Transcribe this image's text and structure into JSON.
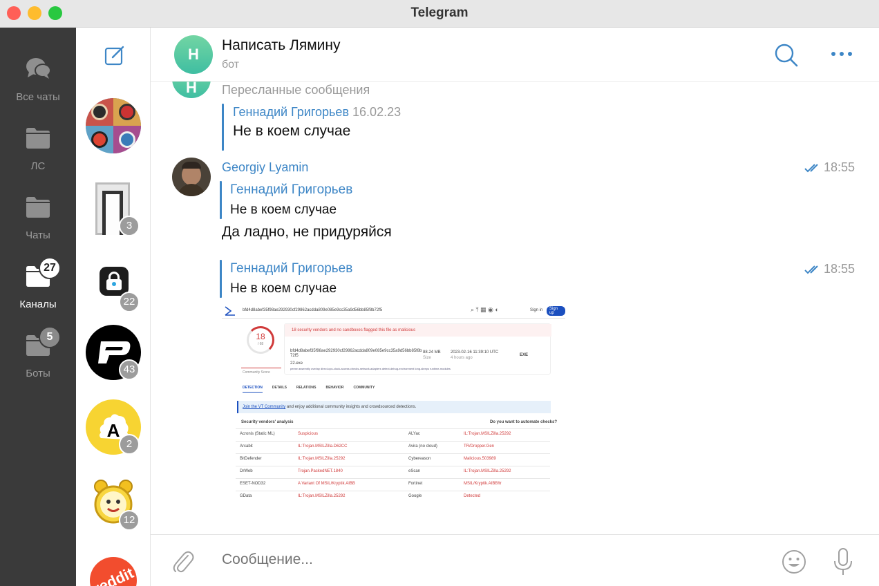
{
  "window": {
    "title": "Telegram"
  },
  "folders": [
    {
      "label": "Все чаты",
      "icon": "chats-bubbles-icon",
      "badge": ""
    },
    {
      "label": "ЛС",
      "icon": "folder-icon",
      "badge": ""
    },
    {
      "label": "Чаты",
      "icon": "folder-icon",
      "badge": ""
    },
    {
      "label": "Каналы",
      "icon": "folder-icon",
      "badge": "27",
      "active": true
    },
    {
      "label": "Боты",
      "icon": "folder-icon",
      "badge": "5"
    }
  ],
  "chat_list": [
    {
      "avatar": "rotary-phones-avatar",
      "badge": ""
    },
    {
      "avatar": "door-avatar",
      "badge": "3"
    },
    {
      "avatar": "lock-avatar",
      "badge": "22"
    },
    {
      "avatar": "p-logo-avatar",
      "badge": "43"
    },
    {
      "avatar": "a-logo-avatar",
      "badge": "2"
    },
    {
      "avatar": "alarm-clock-avatar",
      "badge": "12"
    },
    {
      "avatar": "reddit-avatar",
      "badge": ""
    }
  ],
  "header": {
    "avatar_letter": "Н",
    "name": "Написать Лямину",
    "status": "бот"
  },
  "messages": {
    "forwarded_group": {
      "title": "Пересланные сообщения",
      "author": "Геннадий Григорьев",
      "date": "16.02.23",
      "text": "Не в коем случае"
    },
    "msg1": {
      "sender": "Georgiy Lyamin",
      "time": "18:55",
      "reply_author": "Геннадий Григорьев",
      "reply_text": "Не в коем случае",
      "text": "Да ладно, не придуряйся"
    },
    "msg2": {
      "time": "18:55",
      "reply_author": "Геннадий Григорьев",
      "reply_text": "Не в коем случае"
    }
  },
  "composer": {
    "placeholder": "Сообщение..."
  },
  "vt": {
    "hash": "bfd4d8abef35f98ae292930cf29862acdda809e085e9cc35a9d56bb85f8b72f5",
    "sign_in": "Sign in",
    "sign_up": "Sign up",
    "score": "18",
    "score_total": "/ 68",
    "alert": "18 security vendors and no sandboxes flagged this file as malicious",
    "file_hash_short": "bfd4d8abef35f98ae292930cf29862acdda809e085e9cc35a9d56bb85f8b 72f5",
    "file_name": "22.exe",
    "size": "88.24 MB",
    "size_label": "Size",
    "date": "2023-02-16 11:39:10 UTC",
    "date_ago": "4 hours ago",
    "file_type": "EXE",
    "tags": "peexe   assembly   overlay   direct-cpu-clock-access   checks-network-adapters   detect-debug-environment   long-sleeps   runtime-modules",
    "community_score": "Community Score",
    "tabs": [
      "DETECTION",
      "DETAILS",
      "RELATIONS",
      "BEHAVIOR",
      "COMMUNITY"
    ],
    "banner_link": "Join the VT Community",
    "banner_text": " and enjoy additional community insights and crowdsourced detections.",
    "analysis_title": "Security vendors' analysis",
    "automate": "Do you want to automate checks?",
    "rows": [
      {
        "v1": "Acronis (Static ML)",
        "r1": "Suspicious",
        "v2": "ALYac",
        "r2": "IL:Trojan.MSILZilla.25292"
      },
      {
        "v1": "Arcabit",
        "r1": "IL:Trojan.MSILZilla.D62CC",
        "v2": "Avira (no cloud)",
        "r2": "TR/Dropper.Gen"
      },
      {
        "v1": "BitDefender",
        "r1": "IL:Trojan.MSILZilla.25292",
        "v2": "Cybereason",
        "r2": "Malicious.503989"
      },
      {
        "v1": "DrWeb",
        "r1": "Trojan.PackedNET.1840",
        "v2": "eScan",
        "r2": "IL:Trojan.MSILZilla.25292"
      },
      {
        "v1": "ESET-NOD32",
        "r1": "A Variant Of MSIL/Kryptik.AIBB",
        "v2": "Fortinet",
        "r2": "MSIL/Kryptik.AIBB!tr"
      },
      {
        "v1": "GData",
        "r1": "IL:Trojan.MSILZilla.25292",
        "v2": "Google",
        "r2": "Detected"
      }
    ]
  },
  "colors": {
    "accent": "#3d86c6",
    "rail": "#3a3a3a",
    "avatar_green": "#4fc4a2",
    "danger": "#d03a3a"
  }
}
